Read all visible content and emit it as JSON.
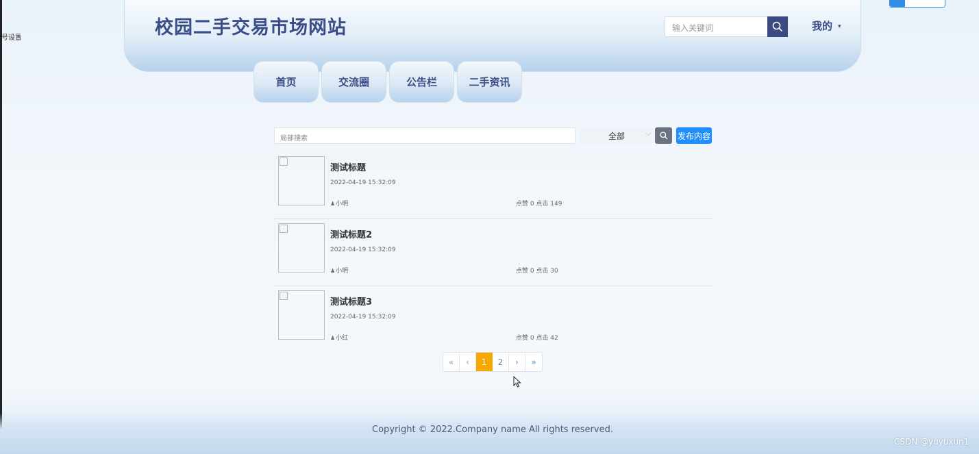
{
  "side_fragment": "号设置",
  "header": {
    "title": "校园二手交易市场网站",
    "search_placeholder": "输入关键词",
    "user_menu": "我的"
  },
  "nav": {
    "items": [
      "首页",
      "交流圈",
      "公告栏",
      "二手资讯"
    ]
  },
  "toolbar": {
    "search_placeholder": "局部搜索",
    "filter_selected": "全部",
    "publish_label": "发布内容"
  },
  "list": {
    "items": [
      {
        "title": "测试标题",
        "date": "2022-04-19 15:32:09",
        "author": "小明",
        "stats": "点赞 0 点击 149"
      },
      {
        "title": "测试标题2",
        "date": "2022-04-19 15:32:09",
        "author": "小明",
        "stats": "点赞 0 点击 30"
      },
      {
        "title": "测试标题3",
        "date": "2022-04-19 15:32:09",
        "author": "小红",
        "stats": "点赞 0 点击 42"
      }
    ]
  },
  "pagination": {
    "first": "«",
    "prev": "‹",
    "pages": [
      "1",
      "2"
    ],
    "current": "1",
    "next": "›",
    "last": "»"
  },
  "footer": {
    "copyright": "Copyright © 2022.Company name All rights reserved."
  },
  "watermark": "CSDN @yuyuxun1",
  "colors": {
    "brand": "#3a4d86",
    "publish": "#1f8fff",
    "active_page": "#f7a800"
  }
}
